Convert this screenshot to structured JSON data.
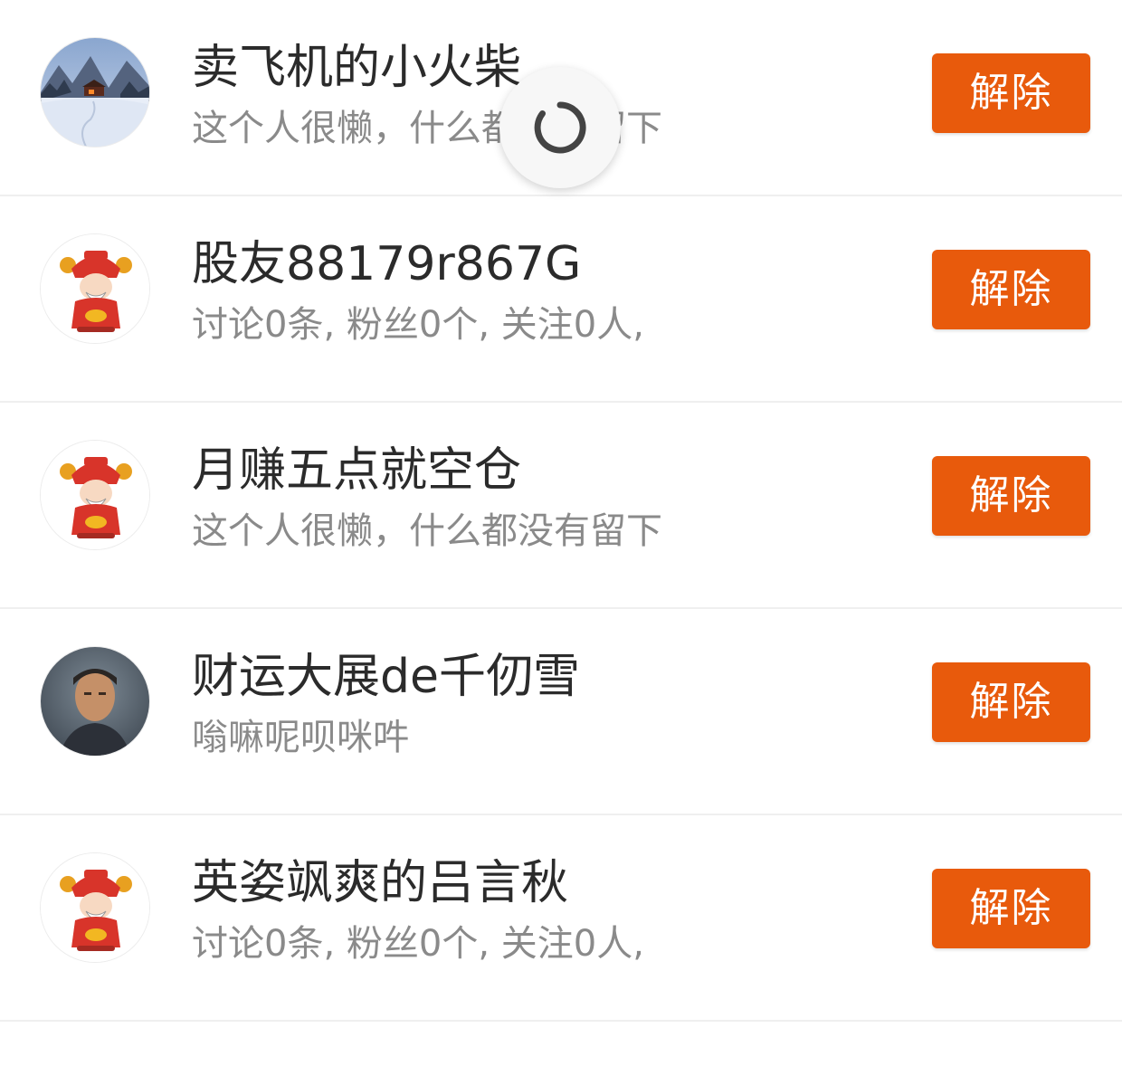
{
  "list": {
    "items": [
      {
        "name": "卖飞机的小火柴",
        "desc": "这个人很懒，什么都没有留下",
        "avatar": "snow-landscape-avatar",
        "button": "解除"
      },
      {
        "name": "股友88179r867G",
        "desc": "讨论0条, 粉丝0个, 关注0人,",
        "avatar": "fortune-god-avatar",
        "button": "解除"
      },
      {
        "name": "月赚五点就空仓",
        "desc": "这个人很懒，什么都没有留下",
        "avatar": "fortune-god-avatar",
        "button": "解除"
      },
      {
        "name": "财运大展de千仞雪",
        "desc": "嗡嘛呢呗咪吽",
        "avatar": "person-photo-avatar",
        "button": "解除"
      },
      {
        "name": "英姿飒爽的吕言秋",
        "desc": "讨论0条, 粉丝0个, 关注0人,",
        "avatar": "fortune-god-avatar",
        "button": "解除"
      }
    ]
  },
  "colors": {
    "accent": "#e85a0c",
    "name_text": "#2b2b2b",
    "desc_text": "#8a8a8a",
    "divider": "#efefef"
  },
  "loading_indicator": {
    "icon": "loading-spinner-icon"
  }
}
